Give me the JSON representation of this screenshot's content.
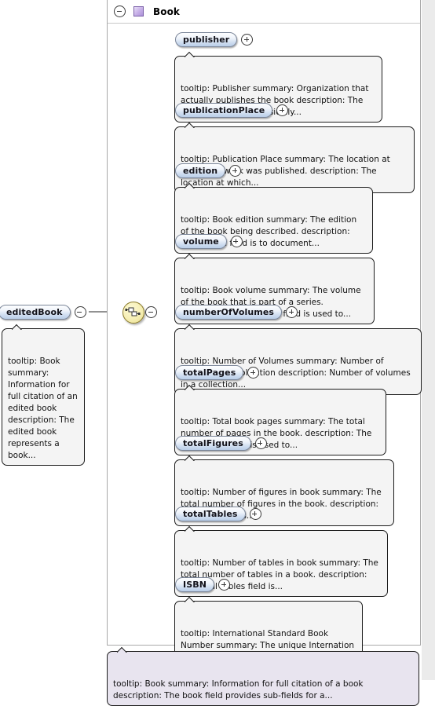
{
  "diagram": {
    "type": "xml-schema-tree",
    "root_panel": {
      "title": "Book",
      "collapse_icon": "minus-circle-icon",
      "element_icon": "purple-element-icon"
    },
    "parent_node": {
      "label": "editedBook",
      "toggle": "minus-circle-icon",
      "tooltip": "tooltip: Book summary: Information for full citation of an edited book description: The edited book represents a book..."
    },
    "compositor": {
      "icon": "sequence-node-icon",
      "toggle": "minus-circle-icon"
    },
    "children": [
      {
        "label": "publisher",
        "toggle": "plus-circle-icon",
        "tooltip": "tooltip: Publisher summary: Organization that actually publishes the book description: The organization that physically..."
      },
      {
        "label": "publicationPlace",
        "toggle": "plus-circle-icon",
        "tooltip": "tooltip: Publication Place summary: The location at which the work was published. description: The location at which..."
      },
      {
        "label": "edition",
        "toggle": "plus-circle-icon",
        "tooltip": "tooltip: Book edition summary: The edition of the book being described. description: The edition field is to document..."
      },
      {
        "label": "volume",
        "toggle": "plus-circle-icon",
        "tooltip": "tooltip: Book volume summary: The volume of the book that is part of a series. description: The volume field is used to..."
      },
      {
        "label": "numberOfVolumes",
        "toggle": "plus-circle-icon",
        "tooltip": "tooltip: Number of Volumes summary: Number of volumes in a collection description: Number of volumes in a collection..."
      },
      {
        "label": "totalPages",
        "toggle": "plus-circle-icon",
        "tooltip": "tooltip: Total book pages summary: The total number of pages in the book. description: The total pages field is used to..."
      },
      {
        "label": "totalFigures",
        "toggle": "plus-circle-icon",
        "tooltip": "tooltip: Number of figures in book summary: The total number of figures in the book. description: the total figures..."
      },
      {
        "label": "totalTables",
        "toggle": "plus-circle-icon",
        "tooltip": "tooltip: Number of tables in book summary: The total number of tables in a book. description: The total tables field is..."
      },
      {
        "label": "ISBN",
        "toggle": "plus-circle-icon",
        "tooltip": "tooltip: International Standard Book Number summary: The unique Internation Standard Book Number description: The ISBN,..."
      }
    ],
    "footer_tooltip": "tooltip: Book summary: Information for full citation of a book description: The book field provides sub-fields for a...",
    "colors": {
      "pill_border": "#7a8598",
      "pill_fill_top": "#fdfeff",
      "pill_fill_bottom": "#b9cde8",
      "element_icon": "#ab8fd8",
      "compositor_fill": "#f6efb4",
      "tooltip_fill": "#f4f4f4",
      "footer_tooltip_fill": "#e8e4ef",
      "panel_border": "#a9a9a9",
      "gutter": "#ebebeb",
      "wire": "#6e6e6e"
    }
  }
}
